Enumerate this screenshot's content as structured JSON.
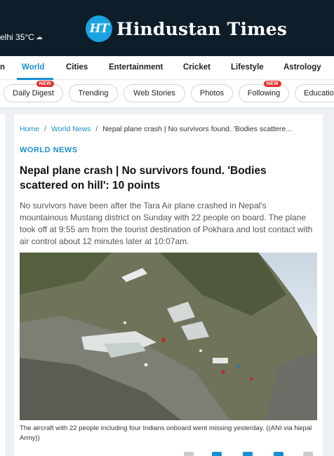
{
  "header": {
    "weather_city_temp": "elhi 35°C",
    "logo_badge": "HT",
    "logo_text": "Hindustan Times"
  },
  "nav": {
    "items": [
      {
        "label": "n"
      },
      {
        "label": "World"
      },
      {
        "label": "Cities"
      },
      {
        "label": "Entertainment"
      },
      {
        "label": "Cricket"
      },
      {
        "label": "Lifestyle"
      },
      {
        "label": "Astrology"
      }
    ],
    "active": "World"
  },
  "pills": {
    "items": [
      {
        "label": "Daily Digest",
        "badge": "NEW"
      },
      {
        "label": "Trending"
      },
      {
        "label": "Web Stories"
      },
      {
        "label": "Photos"
      },
      {
        "label": "Following",
        "badge": "NEW"
      },
      {
        "label": "Educatio"
      }
    ]
  },
  "breadcrumb": {
    "home": "Home",
    "section": "World News",
    "current": "Nepal plane crash | No survivors found. 'Bodies scattere..."
  },
  "article": {
    "category": "WORLD NEWS",
    "headline": "Nepal plane crash | No survivors found. 'Bodies scattered on hill': 10 points",
    "summary": "No survivors have been after the Tara Air plane crashed in Nepal's mountainous Mustang district on Sunday with 22 people on board. The plane took off at 9:55 am from the tourist destination of Pokhara and lost contact with air control about 12 minutes later at 10:07am.",
    "photo_caption": "The aircraft with 22 people including four Indians onboard went missing yesterday. ((ANI via Nepal Army))"
  },
  "colors": {
    "header_bg": "#0d1d29",
    "accent": "#1a8ed1",
    "badge_red": "#e4312b"
  }
}
